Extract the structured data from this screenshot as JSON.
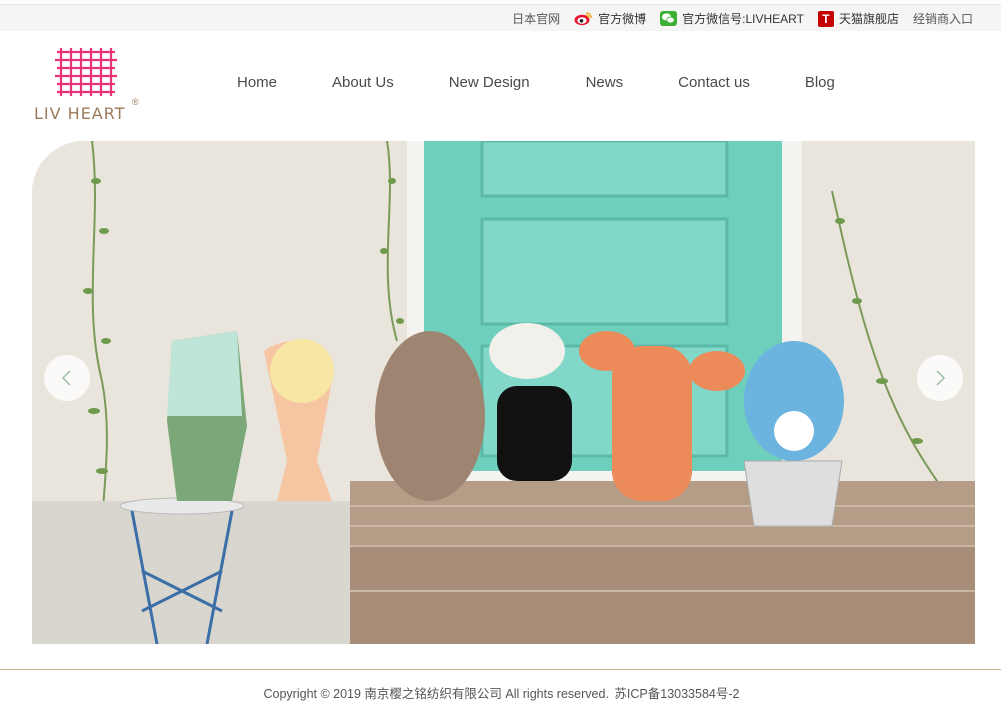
{
  "topbar": {
    "japan_site": "日本官网",
    "weibo": "官方微博",
    "wechat": "官方微信号:LIVHEART",
    "tmall": "天猫旗舰店",
    "tmall_icon_letter": "T",
    "dealer": "经销商入口"
  },
  "brand": {
    "name": "LIV HEART",
    "registered": "®",
    "logo_color": "#e8337a",
    "text_color": "#9a7b5a"
  },
  "nav": {
    "items": [
      "Home",
      "About Us",
      "New Design",
      "News",
      "Contact us",
      "Blog"
    ]
  },
  "hero": {
    "prev_icon": "chevron-left-icon",
    "next_icon": "chevron-right-icon",
    "accent_door_color": "#6fcfbd"
  },
  "footer": {
    "copyright": "Copyright © 2019 南京樱之铭纺织有限公司 All rights reserved.",
    "icp": "苏ICP备13033584号-2"
  }
}
